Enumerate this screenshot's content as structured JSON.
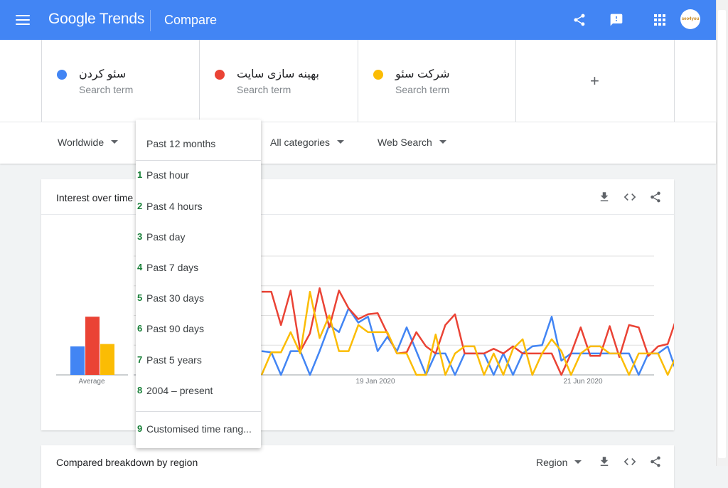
{
  "header": {
    "logo": "Google Trends",
    "page": "Compare",
    "avatar_text": "seo4you"
  },
  "colors": {
    "blue": "#4285f4",
    "red": "#ea4335",
    "yellow": "#fbbc04",
    "header_bg": "#4285f4",
    "selection_number": "#188038"
  },
  "icons": [
    "menu-icon",
    "share-icon",
    "feedback-icon",
    "apps-icon",
    "download-icon",
    "embed-icon",
    "plus-icon",
    "caret-down-icon"
  ],
  "terms": [
    {
      "name": "سئو کردن",
      "sub": "Search term",
      "color": "#4285f4"
    },
    {
      "name": "بهینه سازی سایت",
      "sub": "Search term",
      "color": "#ea4335"
    },
    {
      "name": "شرکت سئو",
      "sub": "Search term",
      "color": "#fbbc04"
    }
  ],
  "add_term": "+",
  "filters": {
    "region": "Worldwide",
    "category": "All categories",
    "property": "Web Search"
  },
  "dropdown": {
    "selected": "Past 12 months",
    "items": [
      {
        "num": "1",
        "label": "Past hour"
      },
      {
        "num": "2",
        "label": "Past 4 hours"
      },
      {
        "num": "3",
        "label": "Past day"
      },
      {
        "num": "4",
        "label": "Past 7 days"
      },
      {
        "num": "5",
        "label": "Past 30 days"
      },
      {
        "num": "6",
        "label": "Past 90 days"
      },
      {
        "num": "7",
        "label": "Past 5 years"
      },
      {
        "num": "8",
        "label": "2004 – present"
      },
      {
        "num": "9",
        "label": "Customised time rang..."
      }
    ]
  },
  "interest_card": {
    "title": "Interest over time",
    "average_label": "Average",
    "x_labels": [
      "19 Jan 2020",
      "21 Jun 2020"
    ]
  },
  "region_card": {
    "title": "Compared breakdown by region",
    "region_select": "Region"
  },
  "chart_data": {
    "type": "line",
    "x_labels_shown": [
      "19 Jan 2020",
      "21 Jun 2020"
    ],
    "ylim": [
      0,
      100
    ],
    "grid": true,
    "averages": [
      {
        "name": "سئو کردن",
        "value": 24
      },
      {
        "name": "بهینه سازی سایت",
        "value": 49
      },
      {
        "name": "شرکت سئو",
        "value": 26
      }
    ],
    "series": [
      {
        "name": "سئو کردن",
        "color": "#4285f4",
        "values": [
          20,
          19,
          0,
          20,
          20,
          0,
          20,
          42,
          36,
          56,
          44,
          49,
          20,
          32,
          20,
          40,
          20,
          0,
          18,
          18,
          0,
          18,
          18,
          18,
          0,
          18,
          0,
          18,
          24,
          25,
          49,
          12,
          18,
          18,
          18,
          18,
          18,
          18,
          18,
          0,
          18,
          18,
          24,
          0,
          18,
          20
        ]
      },
      {
        "name": "بهینه سازی سایت",
        "color": "#ea4335",
        "values": [
          70,
          70,
          42,
          71,
          20,
          35,
          73,
          40,
          71,
          56,
          47,
          51,
          52,
          35,
          18,
          19,
          36,
          24,
          18,
          42,
          51,
          18,
          18,
          18,
          22,
          18,
          24,
          18,
          18,
          18,
          18,
          0,
          18,
          40,
          16,
          16,
          41,
          15,
          42,
          40,
          16,
          24,
          26,
          50,
          32,
          18,
          30
        ]
      },
      {
        "name": "شرکت سئو",
        "color": "#fbbc04",
        "values": [
          0,
          19,
          19,
          36,
          18,
          70,
          31,
          50,
          20,
          20,
          42,
          36,
          36,
          36,
          18,
          18,
          0,
          0,
          34,
          0,
          18,
          24,
          24,
          0,
          18,
          0,
          22,
          30,
          0,
          18,
          30,
          20,
          0,
          18,
          24,
          24,
          18,
          18,
          0,
          18,
          18,
          18,
          0,
          18,
          18,
          44
        ]
      }
    ]
  }
}
